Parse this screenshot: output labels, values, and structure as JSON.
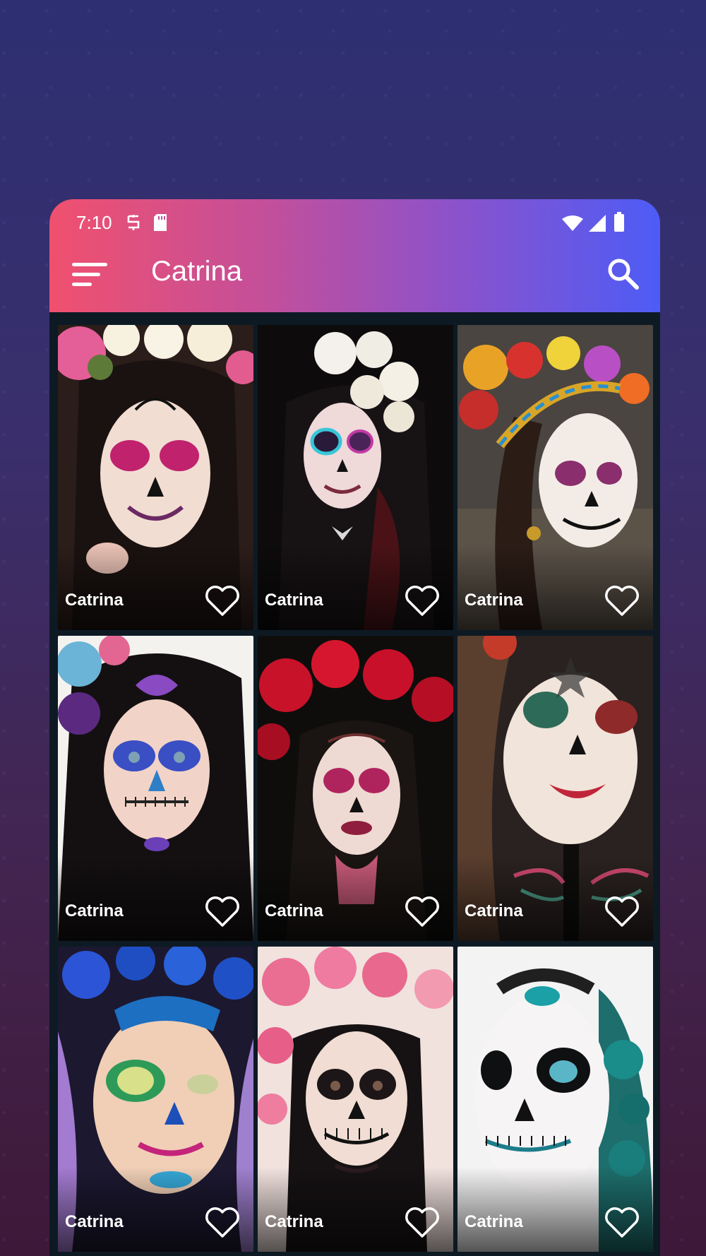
{
  "status_bar": {
    "time": "7:10",
    "left_icons": [
      "storage-icon",
      "sd-card-icon"
    ],
    "right_icons": [
      "wifi-icon",
      "signal-icon",
      "battery-icon"
    ]
  },
  "app_bar": {
    "title": "Catrina",
    "menu_icon": "menu-icon",
    "search_icon": "search-icon",
    "gradient_colors": [
      "#f0506e",
      "#c44f9a",
      "#8e52c9",
      "#4d5cf6"
    ]
  },
  "grid": {
    "items": [
      {
        "label": "Catrina",
        "icon": "heart-outline-icon"
      },
      {
        "label": "Catrina",
        "icon": "heart-outline-icon"
      },
      {
        "label": "Catrina",
        "icon": "heart-outline-icon"
      },
      {
        "label": "Catrina",
        "icon": "heart-outline-icon"
      },
      {
        "label": "Catrina",
        "icon": "heart-outline-icon"
      },
      {
        "label": "Catrina",
        "icon": "heart-outline-icon"
      },
      {
        "label": "Catrina",
        "icon": "heart-outline-icon"
      },
      {
        "label": "Catrina",
        "icon": "heart-outline-icon"
      },
      {
        "label": "Catrina",
        "icon": "heart-outline-icon"
      }
    ]
  }
}
